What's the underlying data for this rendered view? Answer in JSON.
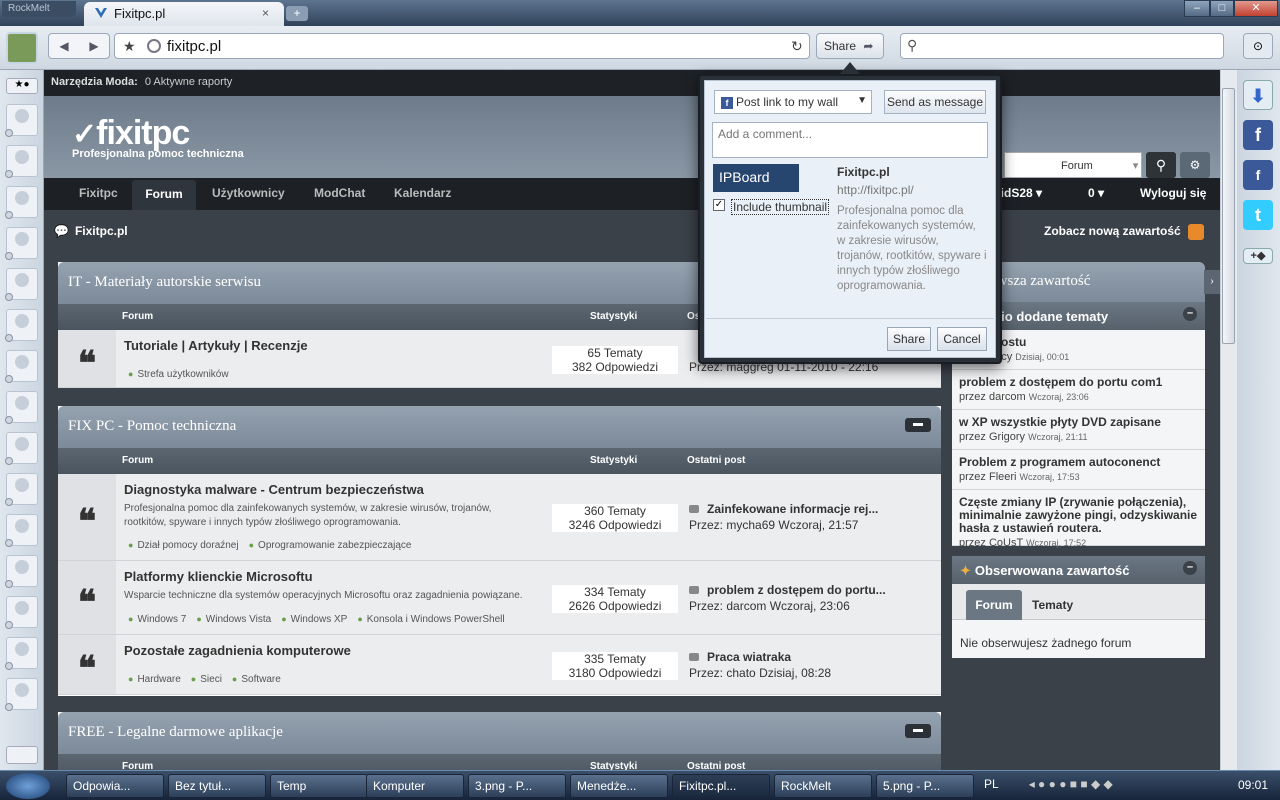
{
  "browser": {
    "app_name": "RockMelt",
    "tab_title": "Fixitpc.pl",
    "tab_close": "×",
    "new_tab": "+",
    "url": "fixitpc.pl",
    "share_label": "Share",
    "window_controls": [
      "–",
      "□",
      "✕"
    ],
    "icons": [
      "back-icon",
      "forward-icon",
      "star-icon",
      "globe-icon",
      "reload-icon",
      "share-icon",
      "search-icon"
    ]
  },
  "mod_bar": {
    "label": "Narzędzia Moda:",
    "reports": "0 Aktywne raporty"
  },
  "site": {
    "logo": "fixitpc",
    "tagline": "Profesjonalna pomoc techniczna",
    "search_scope": "Forum",
    "nav": [
      "Fixitpc",
      "Forum",
      "Użytkownicy",
      "ModChat",
      "Kalendarz"
    ],
    "user": "vidS28",
    "notifications": "0",
    "logout": "Wyloguj się",
    "breadcrumb": "Fixitpc.pl",
    "new_content": "Zobacz nową zawartość"
  },
  "columns": {
    "forum": "Forum",
    "stats": "Statystyki",
    "last": "Ostatni post"
  },
  "categories": [
    {
      "title": "IT - Materiały autorskie serwisu",
      "forums": [
        {
          "title": "Tutoriale | Artykuły | Recenzje",
          "desc": "",
          "subs": [
            "Strefa użytkowników"
          ],
          "topics": "65 Tematy",
          "replies": "382 Odpowiedzi",
          "last_title": "",
          "last_by": "Przez:",
          "last_user": "maggreg",
          "last_date": "01-11-2010 - 22:16"
        }
      ]
    },
    {
      "title": "FIX PC - Pomoc techniczna",
      "forums": [
        {
          "title": "Diagnostyka malware - Centrum bezpieczeństwa",
          "desc": "Profesjonalna pomoc dla zainfekowanych systemów, w zakresie wirusów, trojanów, rootkitów, spyware i innych typów złośliwego oprogramowania.",
          "subs": [
            "Dział pomocy doraźnej",
            "Oprogramowanie zabezpieczające"
          ],
          "topics": "360 Tematy",
          "replies": "3246 Odpowiedzi",
          "last_title": "Zainfekowane informacje rej...",
          "last_by": "Przez:",
          "last_user": "mycha69",
          "last_date": "Wczoraj, 21:57"
        },
        {
          "title": "Platformy klienckie Microsoftu",
          "desc": "Wsparcie techniczne dla systemów operacyjnych Microsoftu oraz zagadnienia powiązane.",
          "subs": [
            "Windows 7",
            "Windows Vista",
            "Windows XP",
            "Konsola i Windows PowerShell"
          ],
          "topics": "334 Tematy",
          "replies": "2626 Odpowiedzi",
          "last_title": "problem z dostępem do portu...",
          "last_by": "Przez:",
          "last_user": "darcom",
          "last_date": "Wczoraj, 23:06"
        },
        {
          "title": "Pozostałe zagadnienia komputerowe",
          "desc": "",
          "subs": [
            "Hardware",
            "Sieci",
            "Software"
          ],
          "topics": "335 Tematy",
          "replies": "3180 Odpowiedzi",
          "last_title": "Praca wiatraka",
          "last_by": "Przez:",
          "last_user": "chato",
          "last_date": "Dzisiaj, 08:28"
        }
      ]
    },
    {
      "title": "FREE - Legalne darmowe aplikacje",
      "forums": []
    }
  ],
  "sidebar": {
    "recent_header": "Najnowsza zawartość",
    "recent_topics_header": "Ostatnio dodane tematy",
    "topics": [
      {
        "title": "Zapis postu",
        "by": "przez",
        "user": "Ifacy",
        "date": "Dzisiaj, 00:01"
      },
      {
        "title": "problem z dostępem do portu com1",
        "by": "przez",
        "user": "darcom",
        "date": "Wczoraj, 23:06"
      },
      {
        "title": "w XP wszystkie płyty DVD zapisane",
        "by": "przez",
        "user": "Grigory",
        "date": "Wczoraj, 21:11"
      },
      {
        "title": "Problem z programem autoconenct",
        "by": "przez",
        "user": "Fleeri",
        "date": "Wczoraj, 17:53"
      },
      {
        "title": "Częste zmiany IP (zrywanie połączenia), minimalnie zawyżone pingi, odzyskiwanie hasła z ustawień routera.",
        "by": "przez",
        "user": "CoUsT",
        "date": "Wczoraj, 17:52"
      }
    ],
    "watched_header": "Obserwowana zawartość",
    "watched_tabs": [
      "Forum",
      "Tematy"
    ],
    "watched_empty": "Nie obserwujesz żadnego forum"
  },
  "share_popup": {
    "target": "Post link to my wall",
    "send_message": "Send as message",
    "comment_placeholder": "Add a comment...",
    "thumb_brand": "IPBoard",
    "include_thumbnail": "Include thumbnail",
    "include_thumbnail_checked": true,
    "preview_title": "Fixitpc.pl",
    "preview_url": "http://fixitpc.pl/",
    "preview_desc": "Profesjonalna pomoc dla zainfekowanych systemów, w zakresie wirusów, trojanów, rootkitów, spyware i innych typów złośliwego oprogramowania.",
    "share": "Share",
    "cancel": "Cancel"
  },
  "taskbar": {
    "items": [
      "Odpowia...",
      "Bez tytuł...",
      "Temp",
      "Komputer",
      "3.png - P...",
      "Menedże...",
      "Fixitpc.pl...",
      "RockMelt",
      "5.png - P..."
    ],
    "active_index": 6,
    "lang": "PL",
    "clock": "09:01"
  },
  "colors": {
    "facebook": "#3b5998",
    "twitter": "#33ccff",
    "rss": "#e98a2a",
    "ipboard": "#26456f"
  }
}
